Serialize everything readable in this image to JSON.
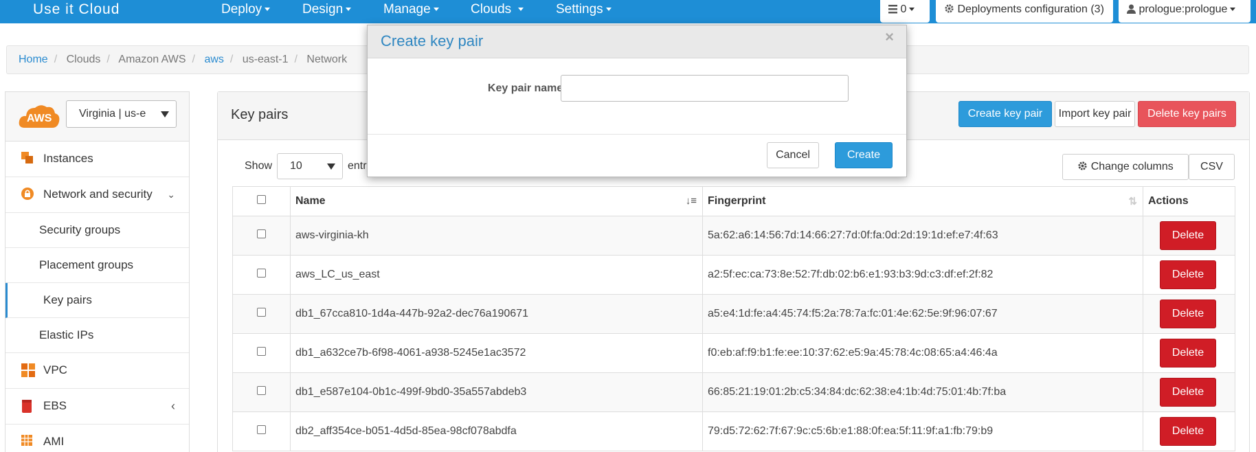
{
  "navbar": {
    "brand": "Use it Cloud",
    "menu": [
      "Deploy",
      "Design",
      "Manage",
      "Clouds",
      "Settings"
    ],
    "tasks_count": "0",
    "deployments_config": "Deployments configuration (3)",
    "user": "prologue:prologue"
  },
  "breadcrumb": [
    "Home",
    "Clouds",
    "Amazon AWS",
    "aws",
    "us-east-1",
    "Network"
  ],
  "sidebar": {
    "logo_text": "AWS",
    "region": "Virginia | us-e",
    "items": {
      "instances": "Instances",
      "network_security": "Network and security",
      "security_groups": "Security groups",
      "placement_groups": "Placement groups",
      "key_pairs": "Key pairs",
      "elastic_ips": "Elastic IPs",
      "vpc": "VPC",
      "ebs": "EBS",
      "ami": "AMI"
    }
  },
  "panel": {
    "title": "Key pairs",
    "create_btn": "Create key pair",
    "import_btn": "Import key pair",
    "delete_btn": "Delete key pairs",
    "show_label": "Show",
    "page_length": "10",
    "entries_label": "entr",
    "change_columns": "Change columns",
    "csv": "CSV"
  },
  "table": {
    "headers": {
      "name": "Name",
      "fingerprint": "Fingerprint",
      "actions": "Actions"
    },
    "delete_label": "Delete",
    "rows": [
      {
        "name": "aws-virginia-kh",
        "fingerprint": "5a:62:a6:14:56:7d:14:66:27:7d:0f:fa:0d:2d:19:1d:ef:e7:4f:63"
      },
      {
        "name": "aws_LC_us_east",
        "fingerprint": "a2:5f:ec:ca:73:8e:52:7f:db:02:b6:e1:93:b3:9d:c3:df:ef:2f:82"
      },
      {
        "name": "db1_67cca810-1d4a-447b-92a2-dec76a190671",
        "fingerprint": "a5:e4:1d:fe:a4:45:74:f5:2a:78:7a:fc:01:4e:62:5e:9f:96:07:67"
      },
      {
        "name": "db1_a632ce7b-6f98-4061-a938-5245e1ac3572",
        "fingerprint": "f0:eb:af:f9:b1:fe:ee:10:37:62:e5:9a:45:78:4c:08:65:a4:46:4a"
      },
      {
        "name": "db1_e587e104-0b1c-499f-9bd0-35a557abdeb3",
        "fingerprint": "66:85:21:19:01:2b:c5:34:84:dc:62:38:e4:1b:4d:75:01:4b:7f:ba"
      },
      {
        "name": "db2_aff354ce-b051-4d5d-85ea-98cf078abdfa",
        "fingerprint": "79:d5:72:62:7f:67:9c:c5:6b:e1:88:0f:ea:5f:11:9f:a1:fb:79:b9"
      }
    ]
  },
  "modal": {
    "title": "Create key pair",
    "close": "×",
    "field_label": "Key pair name",
    "required_mark": "*",
    "input_value": "",
    "cancel": "Cancel",
    "create": "Create"
  },
  "colors": {
    "navbar": "#1e8ed6",
    "primary": "#2d9bdb",
    "danger": "#d01d26",
    "danger_light": "#e8545b",
    "link": "#2a8bd0"
  }
}
